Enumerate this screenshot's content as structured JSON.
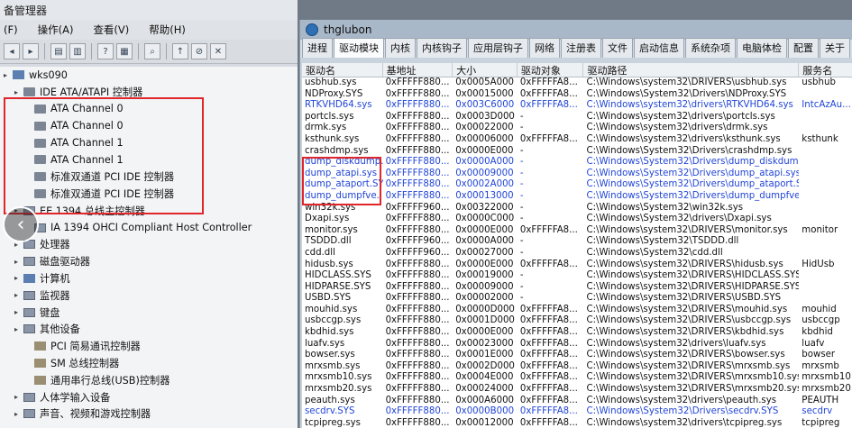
{
  "devmgr": {
    "title": "备管理器",
    "menu": [
      "(F)",
      "操作(A)",
      "查看(V)",
      "帮助(H)"
    ],
    "tree": [
      {
        "label": "wks090",
        "indent": 0,
        "icon": "computer-icon"
      },
      {
        "label": "IDE ATA/ATAPI 控制器",
        "indent": 1,
        "icon": "ide-controller-icon"
      },
      {
        "label": "ATA Channel 0",
        "indent": 2,
        "icon": "ide-channel-icon"
      },
      {
        "label": "ATA Channel 0",
        "indent": 2,
        "icon": "ide-channel-icon"
      },
      {
        "label": "ATA Channel 1",
        "indent": 2,
        "icon": "ide-channel-icon"
      },
      {
        "label": "ATA Channel 1",
        "indent": 2,
        "icon": "ide-channel-icon"
      },
      {
        "label": "标准双通道 PCI IDE 控制器",
        "indent": 2,
        "icon": "ide-channel-icon"
      },
      {
        "label": "标准双通道 PCI IDE 控制器",
        "indent": 2,
        "icon": "ide-channel-icon"
      },
      {
        "label": "EE 1394 总线主控制器",
        "indent": 1,
        "icon": "firewire-icon"
      },
      {
        "label": "IA 1394 OHCI Compliant Host Controller",
        "indent": 2,
        "icon": "firewire-icon"
      },
      {
        "label": "处理器",
        "indent": 1,
        "icon": "processor-icon"
      },
      {
        "label": "磁盘驱动器",
        "indent": 1,
        "icon": "disk-icon"
      },
      {
        "label": "计算机",
        "indent": 1,
        "icon": "computer-icon"
      },
      {
        "label": "监视器",
        "indent": 1,
        "icon": "monitor-icon"
      },
      {
        "label": "键盘",
        "indent": 1,
        "icon": "keyboard-icon"
      },
      {
        "label": "其他设备",
        "indent": 1,
        "icon": "other-device-icon"
      },
      {
        "label": "PCI 简易通讯控制器",
        "indent": 2,
        "icon": "unknown-device-icon"
      },
      {
        "label": "SM 总线控制器",
        "indent": 2,
        "icon": "unknown-device-icon"
      },
      {
        "label": "通用串行总线(USB)控制器",
        "indent": 2,
        "icon": "unknown-device-icon"
      },
      {
        "label": "人体学输入设备",
        "indent": 1,
        "icon": "hid-icon"
      },
      {
        "label": "声音、视频和游戏控制器",
        "indent": 1,
        "icon": "sound-icon"
      }
    ]
  },
  "tool": {
    "title": "thglubon",
    "tabs": [
      "进程",
      "驱动模块",
      "内核",
      "内核钩子",
      "应用层钩子",
      "网络",
      "注册表",
      "文件",
      "启动信息",
      "系统杂项",
      "电脑体检",
      "配置",
      "关于"
    ],
    "active_tab": 1,
    "columns": [
      "驱动名",
      "基地址",
      "大小",
      "驱动对象",
      "驱动路径",
      "服务名"
    ],
    "rows": [
      [
        "usbhub.sys",
        "0xFFFFF880...",
        "0x0005A000",
        "0xFFFFFA8...",
        "C:\\Windows\\system32\\DRIVERS\\usbhub.sys",
        "usbhub"
      ],
      [
        "NDProxy.SYS",
        "0xFFFFF880...",
        "0x00015000",
        "0xFFFFFA8...",
        "C:\\Windows\\System32\\Drivers\\NDProxy.SYS",
        ""
      ],
      [
        "RTKVHD64.sys",
        "0xFFFFF880...",
        "0x003C6000",
        "0xFFFFFA8...",
        "C:\\Windows\\system32\\drivers\\RTKVHD64.sys",
        "IntcAzAu..."
      ],
      [
        "portcls.sys",
        "0xFFFFF880...",
        "0x0003D000",
        "-",
        "C:\\Windows\\system32\\drivers\\portcls.sys",
        ""
      ],
      [
        "drmk.sys",
        "0xFFFFF880...",
        "0x00022000",
        "-",
        "C:\\Windows\\system32\\drivers\\drmk.sys",
        ""
      ],
      [
        "ksthunk.sys",
        "0xFFFFF880...",
        "0x00006000",
        "0xFFFFFA8...",
        "C:\\Windows\\system32\\drivers\\ksthunk.sys",
        "ksthunk"
      ],
      [
        "crashdmp.sys",
        "0xFFFFF880...",
        "0x0000E000",
        "-",
        "C:\\Windows\\System32\\Drivers\\crashdmp.sys",
        ""
      ],
      [
        "dump_diskdump....",
        "0xFFFFF880...",
        "0x0000A000",
        "-",
        "C:\\Windows\\System32\\Drivers\\dump_diskdump.sys",
        ""
      ],
      [
        "dump_atapi.sys",
        "0xFFFFF880...",
        "0x00009000",
        "-",
        "C:\\Windows\\System32\\Drivers\\dump_atapi.sys",
        ""
      ],
      [
        "dump_ataport.SYS",
        "0xFFFFF880...",
        "0x0002A000",
        "-",
        "C:\\Windows\\System32\\Drivers\\dump_ataport.SYS",
        ""
      ],
      [
        "dump_dumpfve....",
        "0xFFFFF880...",
        "0x00013000",
        "-",
        "C:\\Windows\\System32\\Drivers\\dump_dumpfve.sys",
        ""
      ],
      [
        "win32k.sys",
        "0xFFFFF960...",
        "0x00322000",
        "-",
        "C:\\Windows\\System32\\win32k.sys",
        ""
      ],
      [
        "Dxapi.sys",
        "0xFFFFF880...",
        "0x0000C000",
        "-",
        "C:\\Windows\\System32\\drivers\\Dxapi.sys",
        ""
      ],
      [
        "monitor.sys",
        "0xFFFFF880...",
        "0x0000E000",
        "0xFFFFFA8...",
        "C:\\Windows\\system32\\DRIVERS\\monitor.sys",
        "monitor"
      ],
      [
        "TSDDD.dll",
        "0xFFFFF960...",
        "0x0000A000",
        "-",
        "C:\\Windows\\System32\\TSDDD.dll",
        ""
      ],
      [
        "cdd.dll",
        "0xFFFFF960...",
        "0x00027000",
        "-",
        "C:\\Windows\\System32\\cdd.dll",
        ""
      ],
      [
        "hidusb.sys",
        "0xFFFFF880...",
        "0x0000E000",
        "0xFFFFFA8...",
        "C:\\Windows\\system32\\DRIVERS\\hidusb.sys",
        "HidUsb"
      ],
      [
        "HIDCLASS.SYS",
        "0xFFFFF880...",
        "0x00019000",
        "-",
        "C:\\Windows\\system32\\DRIVERS\\HIDCLASS.SYS",
        ""
      ],
      [
        "HIDPARSE.SYS",
        "0xFFFFF880...",
        "0x00009000",
        "-",
        "C:\\Windows\\system32\\DRIVERS\\HIDPARSE.SYS",
        ""
      ],
      [
        "USBD.SYS",
        "0xFFFFF880...",
        "0x00002000",
        "-",
        "C:\\Windows\\system32\\DRIVERS\\USBD.SYS",
        ""
      ],
      [
        "mouhid.sys",
        "0xFFFFF880...",
        "0x0000D000",
        "0xFFFFFA8...",
        "C:\\Windows\\system32\\DRIVERS\\mouhid.sys",
        "mouhid"
      ],
      [
        "usbccgp.sys",
        "0xFFFFF880...",
        "0x0001D000",
        "0xFFFFFA8...",
        "C:\\Windows\\system32\\DRIVERS\\usbccgp.sys",
        "usbccgp"
      ],
      [
        "kbdhid.sys",
        "0xFFFFF880...",
        "0x0000E000",
        "0xFFFFFA8...",
        "C:\\Windows\\system32\\DRIVERS\\kbdhid.sys",
        "kbdhid"
      ],
      [
        "luafv.sys",
        "0xFFFFF880...",
        "0x00023000",
        "0xFFFFFA8...",
        "C:\\Windows\\system32\\drivers\\luafv.sys",
        "luafv"
      ],
      [
        "bowser.sys",
        "0xFFFFF880...",
        "0x0001E000",
        "0xFFFFFA8...",
        "C:\\Windows\\system32\\DRIVERS\\bowser.sys",
        "bowser"
      ],
      [
        "mrxsmb.sys",
        "0xFFFFF880...",
        "0x0002D000",
        "0xFFFFFA8...",
        "C:\\Windows\\system32\\DRIVERS\\mrxsmb.sys",
        "mrxsmb"
      ],
      [
        "mrxsmb10.sys",
        "0xFFFFF880...",
        "0x0004E000",
        "0xFFFFFA8...",
        "C:\\Windows\\system32\\DRIVERS\\mrxsmb10.sys",
        "mrxsmb10"
      ],
      [
        "mrxsmb20.sys",
        "0xFFFFF880...",
        "0x00024000",
        "0xFFFFFA8...",
        "C:\\Windows\\system32\\DRIVERS\\mrxsmb20.sys",
        "mrxsmb20"
      ],
      [
        "peauth.sys",
        "0xFFFFF880...",
        "0x000A6000",
        "0xFFFFFA8...",
        "C:\\Windows\\system32\\drivers\\peauth.sys",
        "PEAUTH"
      ],
      [
        "secdrv.SYS",
        "0xFFFFF880...",
        "0x0000B000",
        "0xFFFFFA8...",
        "C:\\Windows\\System32\\Drivers\\secdrv.SYS",
        "secdrv"
      ],
      [
        "tcpipreg.sys",
        "0xFFFFF880...",
        "0x00012000",
        "0xFFFFFA8...",
        "C:\\Windows\\system32\\drivers\\tcpipreg.sys",
        "tcpipreg"
      ]
    ],
    "blue_rows": [
      2,
      7,
      8,
      9,
      10,
      29
    ]
  }
}
